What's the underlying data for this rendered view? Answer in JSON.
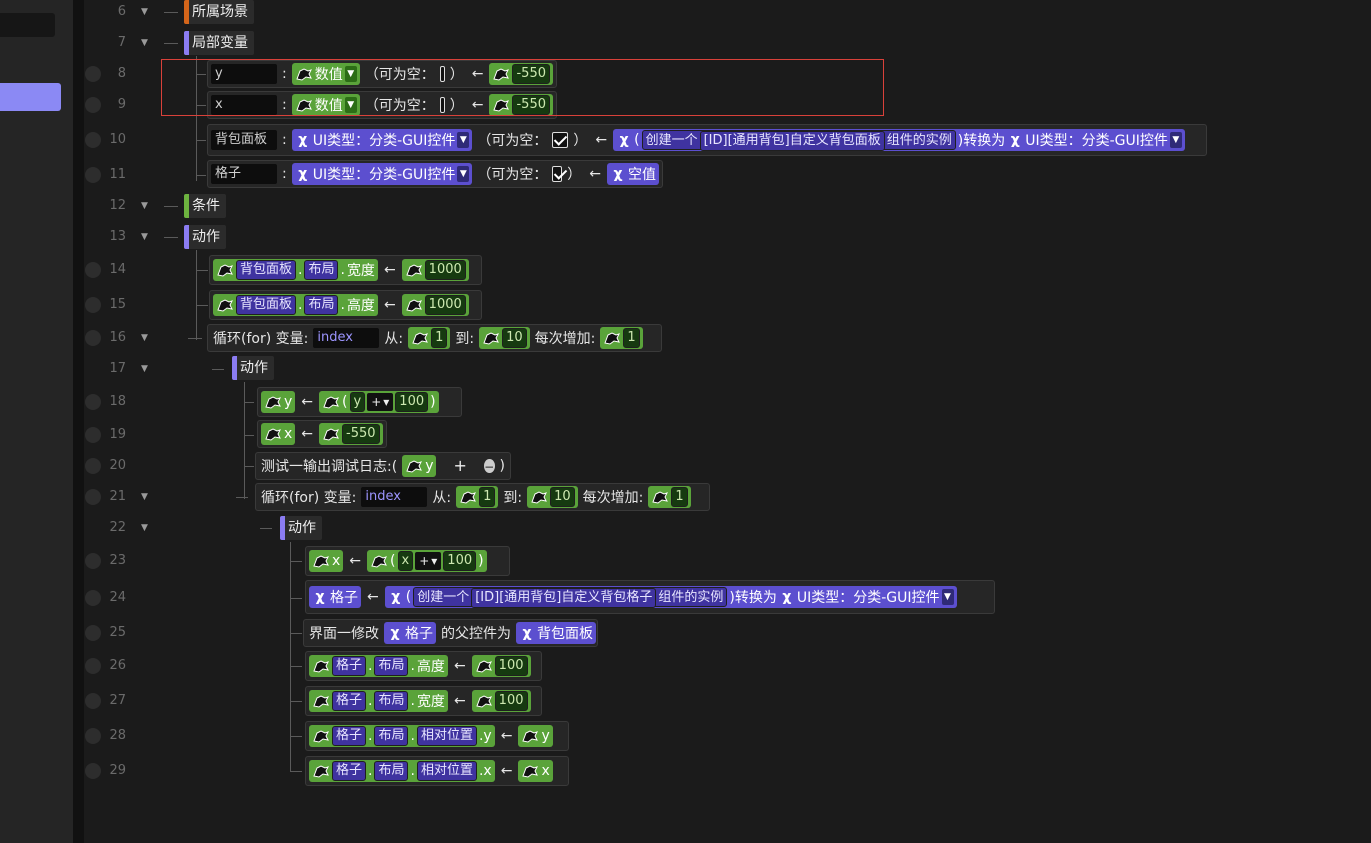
{
  "lines": [
    "6",
    "7",
    "8",
    "9",
    "10",
    "11",
    "12",
    "13",
    "14",
    "15",
    "16",
    "17",
    "18",
    "19",
    "20",
    "21",
    "22",
    "23",
    "24",
    "25",
    "26",
    "27",
    "28",
    "29"
  ],
  "sections": {
    "scene": "所属场景",
    "local_vars": "局部变量",
    "condition": "条件",
    "actions": "动作",
    "inner_actions": "动作",
    "inner_actions2": "动作"
  },
  "words": {
    "type_number": "数值",
    "nullable": "（可为空：",
    "close_paren": "）",
    "arrow": "←",
    "colon": ":",
    "ui_type": "UI类型：分类-GUI控件",
    "create_instance": "创建一个",
    "component_instance": "组件的实例",
    "convert_to": ")转换为",
    "open_paren": "(",
    "close_p": ")",
    "dot": ".",
    "null_value": "空值",
    "loop_for": "循环(for) 变量:",
    "from": "从:",
    "to": "到:",
    "step": "每次增加:",
    "plus": "+",
    "debug_log": "测试一输出调试日志:(",
    "set_parent": "界面一修改",
    "parent_is": "的父控件为",
    "layout": "布局",
    "width": "宽度",
    "height": "高度",
    "rel_pos": "相对位置",
    "dot_y": ".y",
    "dot_x": ".x",
    "nullable_colon": "（可为空：",
    "nullable_close": "）"
  },
  "vars": {
    "y": "y",
    "x": "x",
    "bag_panel": "背包面板",
    "cell": "格子",
    "index": "index"
  },
  "values": {
    "neg550": "-550",
    "w1000": "1000",
    "h1000": "1000",
    "one": "1",
    "ten": "10",
    "hundred": "100"
  },
  "ids": {
    "bag_panel_id": "[ID][通用背包]自定义背包面板",
    "bag_cell_id": "[ID][通用背包]自定义背包格子"
  },
  "icons": {
    "node_icon": "dragon-icon",
    "x_icon": "variable-x-icon",
    "dropdown": "chevron-down-icon"
  },
  "colors": {
    "orange": "#d4651a",
    "purple": "#8b7cf2",
    "green": "#6db33f",
    "block_green": "#5aa33a",
    "block_purple": "#5c4fcf",
    "selection": "#d9413a"
  }
}
